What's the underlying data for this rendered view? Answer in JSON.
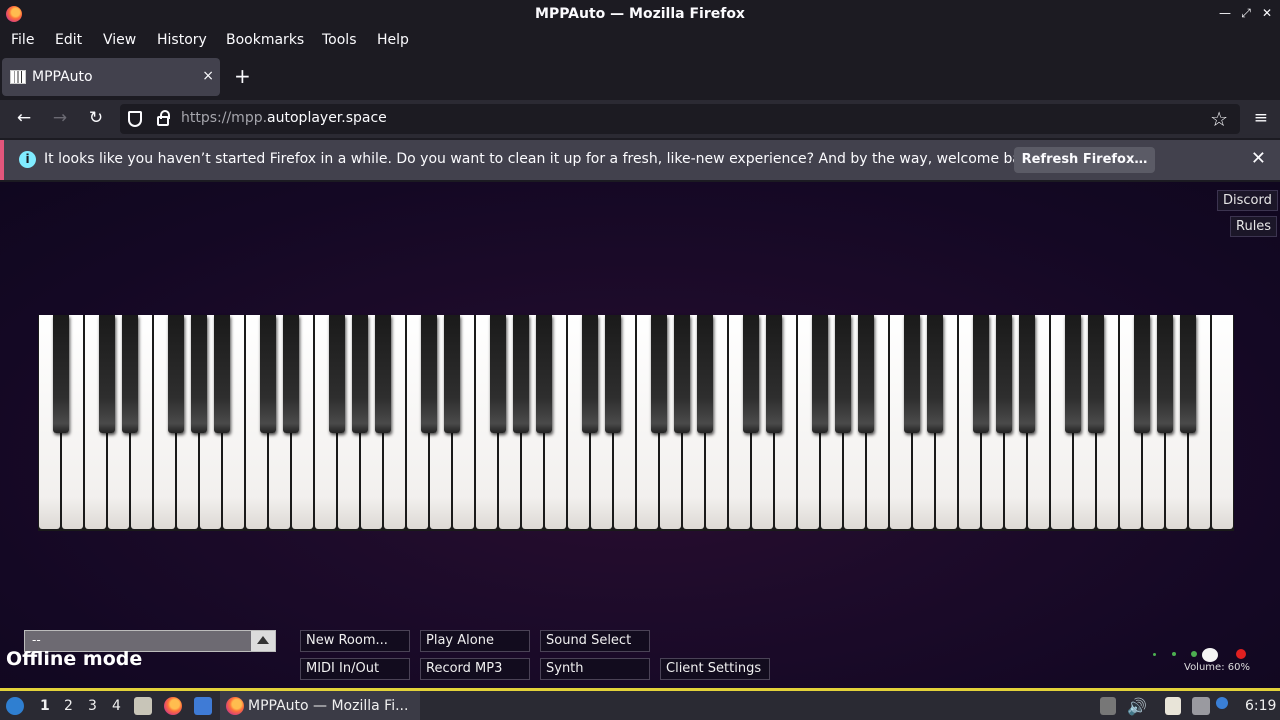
{
  "window": {
    "title": "MPPAuto — Mozilla Firefox",
    "controls": {
      "minimize": "—",
      "maximize": "⤢",
      "close": "✕"
    }
  },
  "menubar": {
    "items": [
      {
        "label": "File"
      },
      {
        "label": "Edit"
      },
      {
        "label": "View"
      },
      {
        "label": "History"
      },
      {
        "label": "Bookmarks"
      },
      {
        "label": "Tools"
      },
      {
        "label": "Help"
      }
    ]
  },
  "tabs": [
    {
      "label": "MPPAuto",
      "close": "×",
      "icon": "piano-favicon-icon"
    }
  ],
  "newtab_glyph": "+",
  "navbar": {
    "back": "←",
    "forward": "→",
    "reload": "↻",
    "url_prefix": "https://mpp.",
    "url_domain": "autoplayer.space",
    "bookmark_star": "☆",
    "menu": "≡"
  },
  "infobar": {
    "icon": "i",
    "message": "It looks like you haven’t started Firefox in a while. Do you want to clean it up for a fresh, like-new experience? And by the way, welcome back!",
    "button": "Refresh Firefox…",
    "close": "✕"
  },
  "page": {
    "discord": "Discord",
    "rules": "Rules",
    "room_select_value": "--",
    "offline": "Offline mode",
    "buttons_row1": [
      "New Room...",
      "Play Alone",
      "Sound Select"
    ],
    "buttons_row2": [
      "MIDI In/Out",
      "Record MP3",
      "Synth",
      "Client Settings"
    ],
    "volume_label": "Volume: 60%",
    "volume_level": 0.6,
    "keyboard": {
      "white_keys": 52,
      "black_keys": 36
    }
  },
  "taskbar": {
    "workspaces": [
      "1",
      "2",
      "3",
      "4"
    ],
    "active_workspace": "1",
    "app_label": "MPPAuto — Mozilla Fi...",
    "clock": "6:19",
    "colors": {
      "accent": "#e3d23a"
    }
  }
}
